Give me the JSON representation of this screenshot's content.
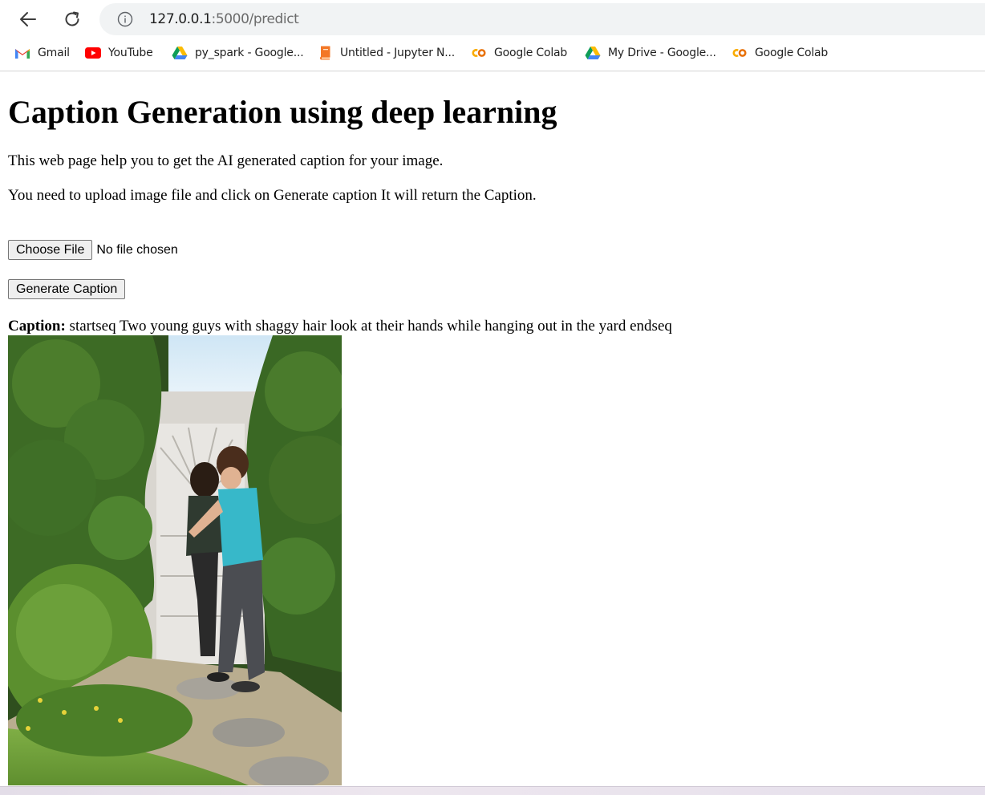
{
  "browser": {
    "url_host": "127.0.0.1",
    "url_path": ":5000/predict",
    "bookmarks": [
      {
        "label": "Gmail",
        "icon": "gmail-icon"
      },
      {
        "label": "YouTube",
        "icon": "youtube-icon"
      },
      {
        "label": "py_spark - Google...",
        "icon": "google-drive-icon"
      },
      {
        "label": "Untitled - Jupyter N...",
        "icon": "jupyter-book-icon"
      },
      {
        "label": "Google Colab",
        "icon": "colab-icon"
      },
      {
        "label": "My Drive - Google...",
        "icon": "google-drive-icon"
      },
      {
        "label": "Google Colab",
        "icon": "colab-icon"
      }
    ]
  },
  "page": {
    "title": "Caption Generation using deep learning",
    "intro_1": "This web page help you to get the AI generated caption for your image.",
    "intro_2": "You need to upload image file and click on Generate caption It will return the Caption.",
    "file_button": "Choose File",
    "file_status": "No file chosen",
    "generate_button": "Generate Caption",
    "caption_label": "Caption:",
    "caption_text": "startseq Two young guys with shaggy hair look at their hands while hanging out in the yard endseq"
  },
  "colors": {
    "omnibox_bg": "#f1f3f4",
    "gmail_red": "#ea4335",
    "youtube_red": "#ff0000",
    "colab_orange": "#f9ab00",
    "jupyter_orange": "#f37726"
  }
}
